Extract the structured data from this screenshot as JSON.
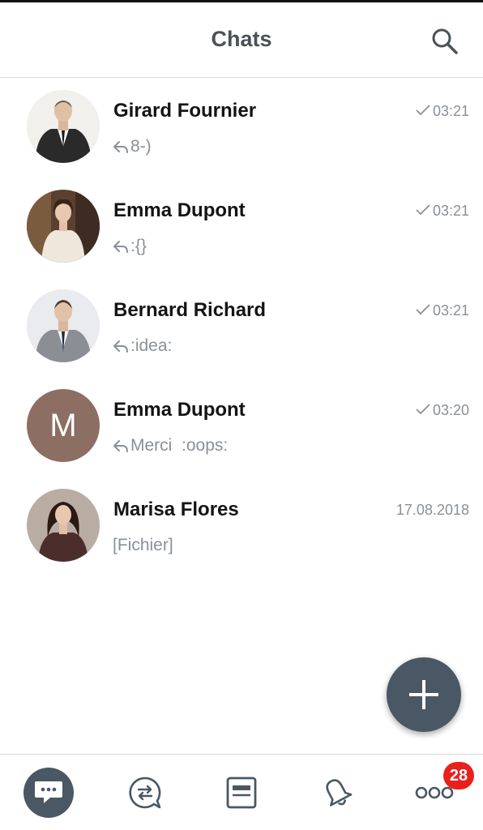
{
  "header": {
    "title": "Chats"
  },
  "chats": [
    {
      "name": "Girard Fournier",
      "time": "03:21",
      "sent": true,
      "reply": true,
      "preview": "8-)"
    },
    {
      "name": "Emma Dupont",
      "time": "03:21",
      "sent": true,
      "reply": true,
      "preview": ":{}"
    },
    {
      "name": "Bernard Richard",
      "time": "03:21",
      "sent": true,
      "reply": true,
      "preview": ":idea:"
    },
    {
      "name": "Emma Dupont",
      "time": "03:20",
      "sent": true,
      "reply": true,
      "preview": "Merci  :oops:",
      "avatar_letter": "M"
    },
    {
      "name": "Marisa Flores",
      "time": "17.08.2018",
      "sent": false,
      "reply": false,
      "preview": "[Fichier]"
    }
  ],
  "fab": {
    "icon": "plus-icon"
  },
  "bottom_nav": {
    "items": [
      {
        "id": "chats",
        "icon": "chat-bubble-icon",
        "active": true
      },
      {
        "id": "conversations",
        "icon": "conversation-icon",
        "active": false
      },
      {
        "id": "feed",
        "icon": "card-icon",
        "active": false
      },
      {
        "id": "notifications",
        "icon": "bell-icon",
        "active": false
      },
      {
        "id": "more",
        "icon": "more-dots-icon",
        "active": false
      }
    ],
    "badge_count": "28"
  },
  "colors": {
    "accent": "#4a5764",
    "badge": "#e8201c",
    "muted_text": "#8a9096",
    "avatar_letter_bg": "#8d6e63"
  }
}
